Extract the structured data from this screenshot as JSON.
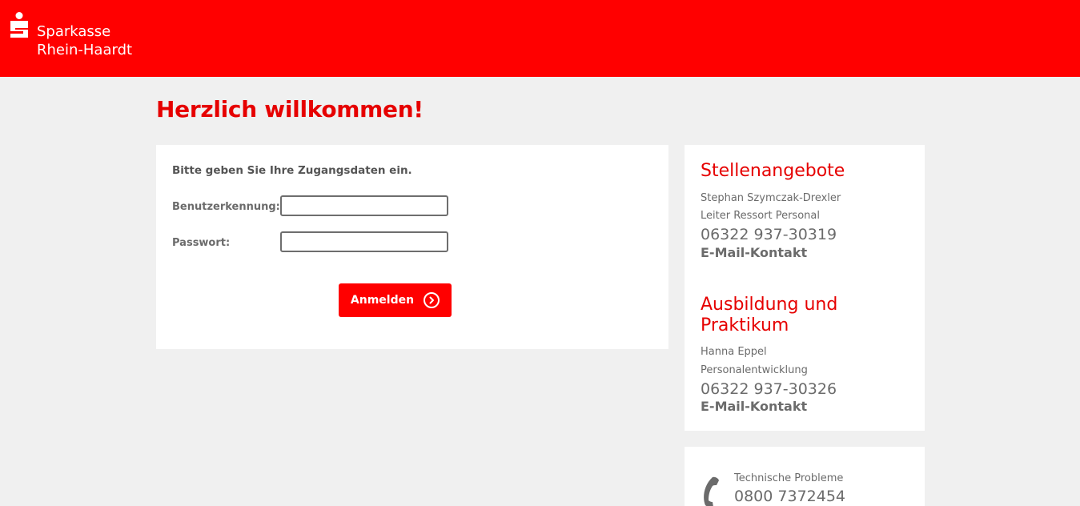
{
  "header": {
    "logo_line1": "Sparkasse",
    "logo_line2": "Rhein-Haardt",
    "brand_color": "#ff0000"
  },
  "main": {
    "title": "Herzlich willkommen!"
  },
  "login": {
    "intro": "Bitte geben Sie Ihre Zugangsdaten ein.",
    "username_label": "Benutzerkennung:",
    "username_value": "",
    "password_label": "Passwort:",
    "password_value": "",
    "submit_label": "Anmelden"
  },
  "contacts": {
    "jobs": {
      "title": "Stellenangebote",
      "name": "Stephan Szymczak-Drexler",
      "role": "Leiter Ressort Personal",
      "phone": "06322 937-30319",
      "email_label": "E-Mail-Kontakt"
    },
    "training": {
      "title": "Ausbildung und Praktikum",
      "name": "Hanna Eppel",
      "role": "Personalentwicklung",
      "phone": "06322 937-30326",
      "email_label": "E-Mail-Kontakt"
    }
  },
  "support": {
    "label": "Technische Probleme",
    "phone": "0800 7372454",
    "icon": "phone-icon"
  }
}
